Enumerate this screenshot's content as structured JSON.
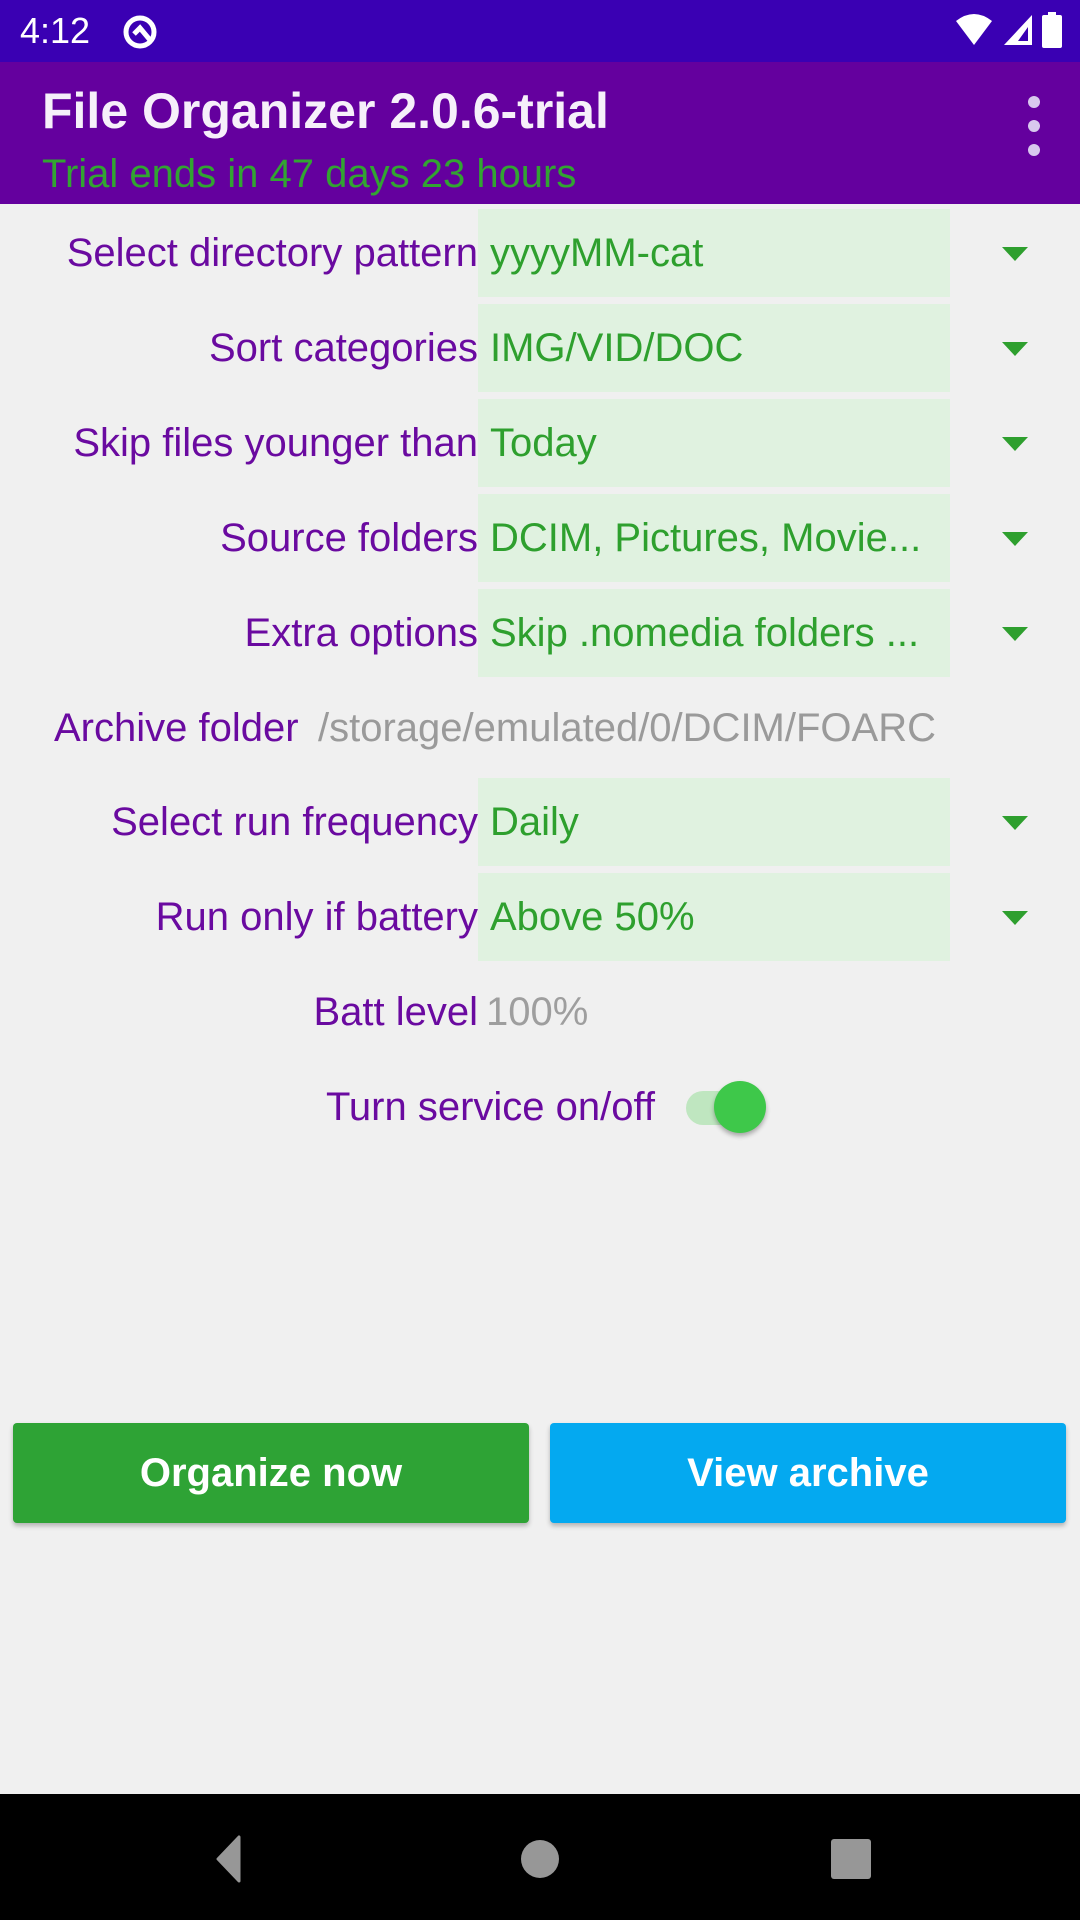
{
  "status_bar": {
    "time": "4:12",
    "icons": [
      "app-notification-icon",
      "wifi-icon",
      "cell-signal-icon",
      "battery-icon"
    ]
  },
  "app_bar": {
    "title": "File Organizer 2.0.6-trial",
    "subtitle": "Trial ends in 47 days 23 hours",
    "menu_icon": "more-vert-icon"
  },
  "settings": {
    "directory_pattern": {
      "label": "Select directory pattern",
      "value": "yyyyMM-cat"
    },
    "sort_categories": {
      "label": "Sort categories",
      "value": "IMG/VID/DOC"
    },
    "skip_younger": {
      "label": "Skip files younger than",
      "value": "Today"
    },
    "source_folders": {
      "label": "Source folders",
      "value": "DCIM, Pictures, Movie..."
    },
    "extra_options": {
      "label": "Extra options",
      "value": "Skip .nomedia folders ..."
    },
    "archive_folder": {
      "label": "Archive folder",
      "value": "/storage/emulated/0/DCIM/FOARC"
    },
    "run_frequency": {
      "label": "Select run frequency",
      "value": "Daily"
    },
    "battery_condition": {
      "label": "Run only if battery",
      "value": "Above 50%"
    },
    "batt_level": {
      "label": "Batt level",
      "value": "100%"
    },
    "service": {
      "label": "Turn service on/off",
      "state": "on"
    }
  },
  "buttons": {
    "organize": "Organize now",
    "view_archive": "View archive"
  },
  "colors": {
    "status_bar": "#3a00b3",
    "app_bar": "#64009e",
    "label": "#6a0aa0",
    "accent_green": "#2ea02e",
    "spinner_bg": "#e0f2e0",
    "organize_button": "#2ea335",
    "archive_button": "#04a9f0"
  },
  "nav_bar": {
    "icons": [
      "back-icon",
      "home-icon",
      "recents-icon"
    ]
  }
}
